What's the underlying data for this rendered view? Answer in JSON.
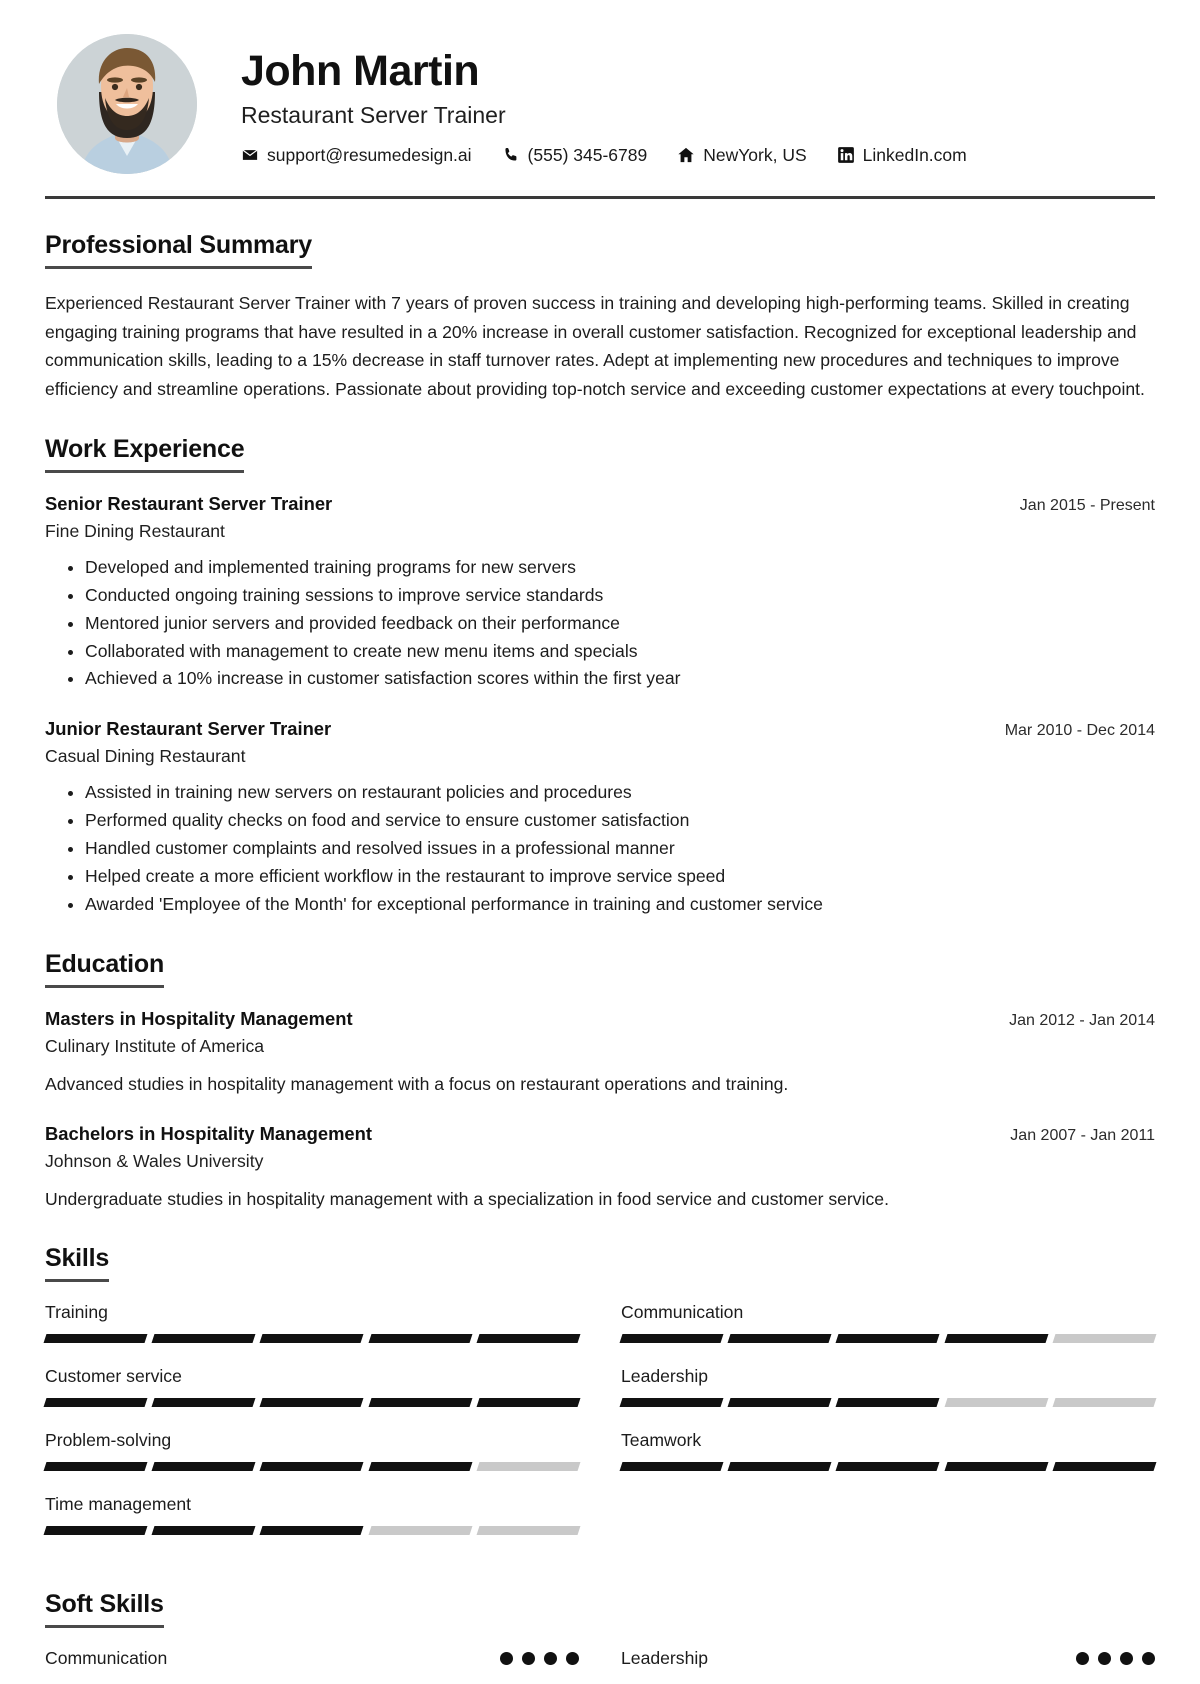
{
  "header": {
    "name": "John Martin",
    "role": "Restaurant Server Trainer",
    "avatar_alt": "profile-photo",
    "contacts": [
      {
        "icon": "email-icon",
        "text": "support@resumedesign.ai"
      },
      {
        "icon": "phone-icon",
        "text": "(555) 345-6789"
      },
      {
        "icon": "home-icon",
        "text": "NewYork, US"
      },
      {
        "icon": "linkedin-icon",
        "text": "LinkedIn.com"
      }
    ]
  },
  "summary": {
    "title": "Professional Summary",
    "text": "Experienced Restaurant Server Trainer with 7 years of proven success in training and developing high-performing teams. Skilled in creating engaging training programs that have resulted in a 20% increase in overall customer satisfaction. Recognized for exceptional leadership and communication skills, leading to a 15% decrease in staff turnover rates. Adept at implementing new procedures and techniques to improve efficiency and streamline operations. Passionate about providing top-notch service and exceeding customer expectations at every touchpoint."
  },
  "work": {
    "title": "Work Experience",
    "entries": [
      {
        "job_title": "Senior Restaurant Server Trainer",
        "company": "Fine Dining Restaurant",
        "date": "Jan 2015 - Present",
        "bullets": [
          "Developed and implemented training programs for new servers",
          "Conducted ongoing training sessions to improve service standards",
          "Mentored junior servers and provided feedback on their performance",
          "Collaborated with management to create new menu items and specials",
          "Achieved a 10% increase in customer satisfaction scores within the first year"
        ]
      },
      {
        "job_title": "Junior Restaurant Server Trainer",
        "company": "Casual Dining Restaurant",
        "date": "Mar 2010 - Dec 2014",
        "bullets": [
          "Assisted in training new servers on restaurant policies and procedures",
          "Performed quality checks on food and service to ensure customer satisfaction",
          "Handled customer complaints and resolved issues in a professional manner",
          "Helped create a more efficient workflow in the restaurant to improve service speed",
          "Awarded 'Employee of the Month' for exceptional performance in training and customer service"
        ]
      }
    ]
  },
  "education": {
    "title": "Education",
    "entries": [
      {
        "degree": "Masters in Hospitality Management",
        "school": "Culinary Institute of America",
        "date": "Jan 2012 - Jan 2014",
        "description": "Advanced studies in hospitality management with a focus on restaurant operations and training."
      },
      {
        "degree": "Bachelors in Hospitality Management",
        "school": "Johnson & Wales University",
        "date": "Jan 2007 - Jan 2011",
        "description": "Undergraduate studies in hospitality management with a specialization in food service and customer service."
      }
    ]
  },
  "skills": {
    "title": "Skills",
    "max_level": 5,
    "items": [
      {
        "name": "Training",
        "level": 5
      },
      {
        "name": "Communication",
        "level": 4
      },
      {
        "name": "Customer service",
        "level": 5
      },
      {
        "name": "Leadership",
        "level": 3
      },
      {
        "name": "Problem-solving",
        "level": 4
      },
      {
        "name": "Teamwork",
        "level": 5
      },
      {
        "name": "Time management",
        "level": 3
      }
    ]
  },
  "soft_skills": {
    "title": "Soft Skills",
    "max_level": 4,
    "items": [
      {
        "name": "Communication",
        "level": 4
      },
      {
        "name": "Leadership",
        "level": 4
      }
    ]
  },
  "colors": {
    "text": "#1a1a1a",
    "rule": "#3a3a3a",
    "bar_on": "#111111",
    "bar_off": "#c9c9c9"
  }
}
